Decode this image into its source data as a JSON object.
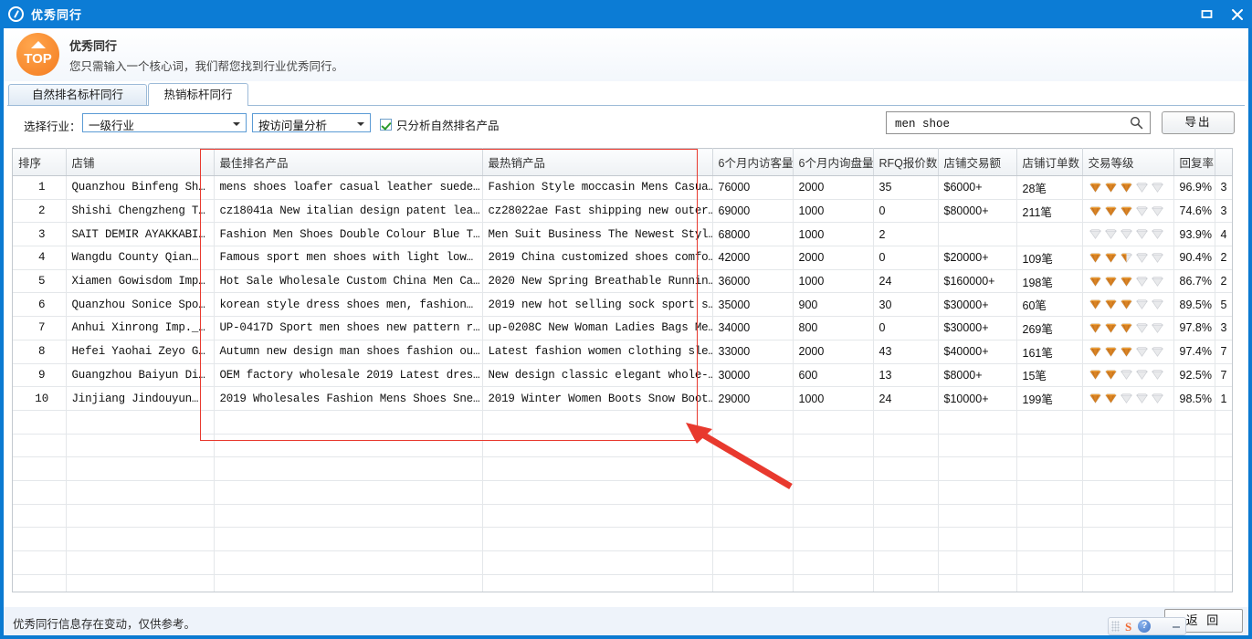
{
  "window": {
    "title": "优秀同行",
    "icon": "app-circle-icon",
    "buttons": {
      "maximize": "□",
      "close": "✕"
    }
  },
  "banner": {
    "logo_text": "TOP",
    "title": "优秀同行",
    "subtitle": "您只需输入一个核心词，我们帮您找到行业优秀同行。"
  },
  "tabs": [
    {
      "label": "自然排名标杆同行",
      "active": false
    },
    {
      "label": "热销标杆同行",
      "active": true
    }
  ],
  "filter": {
    "industry_label": "选择行业：",
    "industry_select": "一级行业",
    "analysis_select": "按访问量分析",
    "checkbox_label": "只分析自然排名产品",
    "checkbox_checked": true,
    "search_value": "men shoe",
    "search_placeholder": "",
    "search_icon": "search-icon",
    "export_button": "导出"
  },
  "grid": {
    "columns": [
      "排序",
      "店铺",
      "最佳排名产品",
      "最热销产品",
      "6个月内访客量",
      "6个月内询盘量",
      "RFQ报价数",
      "店铺交易额",
      "店铺订单数",
      "交易等级",
      "回复率",
      ""
    ],
    "rows": [
      {
        "index": "1",
        "shop": "Quanzhou Binfeng Sh…",
        "best_rank_product": "mens shoes loafer casual leather suede…",
        "hot_product": "Fashion Style moccasin Mens Casua…",
        "visitors_6m": "76000",
        "inquiries_6m": "2000",
        "rfq_quotes": "35",
        "shop_turnover": "$6000+",
        "shop_orders": "28笔",
        "trade_level": 3,
        "reply_rate": "96.9%",
        "last": "3"
      },
      {
        "index": "2",
        "shop": "Shishi Chengzheng T…",
        "best_rank_product": "cz18041a New italian design patent lea…",
        "hot_product": "cz28022ae Fast shipping new outer…",
        "visitors_6m": "69000",
        "inquiries_6m": "1000",
        "rfq_quotes": "0",
        "shop_turnover": "$80000+",
        "shop_orders": "211笔",
        "trade_level": 3,
        "reply_rate": "74.6%",
        "last": "3"
      },
      {
        "index": "3",
        "shop": "SAIT DEMIR AYAKKABI…",
        "best_rank_product": "Fashion Men Shoes Double Colour Blue T…",
        "hot_product": "Men Suit Business The Newest Styl…",
        "visitors_6m": "68000",
        "inquiries_6m": "1000",
        "rfq_quotes": "2",
        "shop_turnover": "",
        "shop_orders": "",
        "trade_level": 0,
        "reply_rate": "93.9%",
        "last": "4"
      },
      {
        "index": "4",
        "shop": "Wangdu County Qian…",
        "best_rank_product": "Famous sport men shoes with light low…",
        "hot_product": "2019 China customized shoes comfo…",
        "visitors_6m": "42000",
        "inquiries_6m": "2000",
        "rfq_quotes": "0",
        "shop_turnover": "$20000+",
        "shop_orders": "109笔",
        "trade_level": 2.5,
        "reply_rate": "90.4%",
        "last": "2"
      },
      {
        "index": "5",
        "shop": "Xiamen Gowisdom Imp…",
        "best_rank_product": "Hot Sale Wholesale Custom China Men Ca…",
        "hot_product": "2020 New Spring Breathable Runnin…",
        "visitors_6m": "36000",
        "inquiries_6m": "1000",
        "rfq_quotes": "24",
        "shop_turnover": "$160000+",
        "shop_orders": "198笔",
        "trade_level": 3,
        "reply_rate": "86.7%",
        "last": "2"
      },
      {
        "index": "6",
        "shop": "Quanzhou Sonice Spo…",
        "best_rank_product": "korean style dress shoes men, fashion…",
        "hot_product": "2019 new hot selling sock sport s…",
        "visitors_6m": "35000",
        "inquiries_6m": "900",
        "rfq_quotes": "30",
        "shop_turnover": "$30000+",
        "shop_orders": "60笔",
        "trade_level": 3,
        "reply_rate": "89.5%",
        "last": "5"
      },
      {
        "index": "7",
        "shop": "Anhui Xinrong Imp._…",
        "best_rank_product": "UP-0417D Sport men shoes new pattern r…",
        "hot_product": "up-0208C New Woman Ladies Bags Me…",
        "visitors_6m": "34000",
        "inquiries_6m": "800",
        "rfq_quotes": "0",
        "shop_turnover": "$30000+",
        "shop_orders": "269笔",
        "trade_level": 3,
        "reply_rate": "97.8%",
        "last": "3"
      },
      {
        "index": "8",
        "shop": "Hefei Yaohai Zeyo G…",
        "best_rank_product": "Autumn new design man shoes fashion ou…",
        "hot_product": "Latest fashion women clothing sle…",
        "visitors_6m": "33000",
        "inquiries_6m": "2000",
        "rfq_quotes": "43",
        "shop_turnover": "$40000+",
        "shop_orders": "161笔",
        "trade_level": 3,
        "reply_rate": "97.4%",
        "last": "7"
      },
      {
        "index": "9",
        "shop": "Guangzhou Baiyun Di…",
        "best_rank_product": "OEM factory wholesale 2019 Latest dres…",
        "hot_product": "New design classic elegant whole-…",
        "visitors_6m": "30000",
        "inquiries_6m": "600",
        "rfq_quotes": "13",
        "shop_turnover": "$8000+",
        "shop_orders": "15笔",
        "trade_level": 2,
        "reply_rate": "92.5%",
        "last": "7"
      },
      {
        "index": "10",
        "shop": "Jinjiang Jindouyun…",
        "best_rank_product": "2019 Wholesales Fashion Mens Shoes Sne…",
        "hot_product": "2019 Winter Women Boots Snow Boot…",
        "visitors_6m": "29000",
        "inquiries_6m": "1000",
        "rfq_quotes": "24",
        "shop_turnover": "$10000+",
        "shop_orders": "199笔",
        "trade_level": 2,
        "reply_rate": "98.5%",
        "last": "1"
      }
    ]
  },
  "annotation": {
    "highlight_color": "#e8392e",
    "arrow_color": "#e8392e"
  },
  "status": {
    "text": "优秀同行信息存在变动，仅供参考。",
    "back_button": "返 回"
  },
  "ime": {
    "brand": "S",
    "help": "?"
  },
  "colors": {
    "title_bar": "#0c7cd5",
    "accent": "#f47c20",
    "link_text": "#1414dc",
    "gem_filled": "#e08a2e"
  }
}
